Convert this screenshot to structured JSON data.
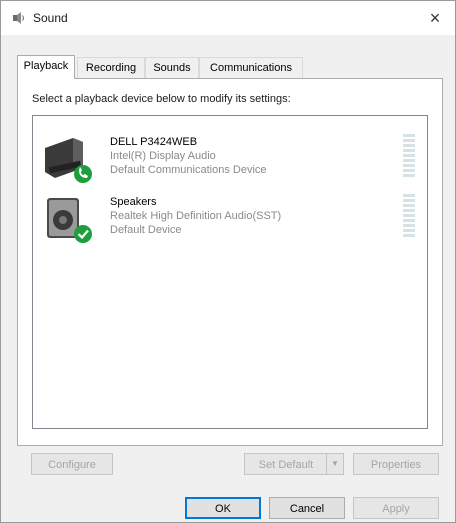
{
  "window": {
    "title": "Sound",
    "close_glyph": "×"
  },
  "tabs": [
    {
      "label": "Playback",
      "active": true
    },
    {
      "label": "Recording",
      "active": false
    },
    {
      "label": "Sounds",
      "active": false
    },
    {
      "label": "Communications",
      "active": false
    }
  ],
  "playback": {
    "instruction": "Select a playback device below to modify its settings:",
    "devices": [
      {
        "name": "DELL P3424WEB",
        "line2": "Intel(R) Display Audio",
        "line3": "Default Communications Device",
        "icon": "monitor-speaker-icon",
        "badge": "phone-badge-icon",
        "badge_color": "#1e9e3e"
      },
      {
        "name": "Speakers",
        "line2": "Realtek High Definition Audio(SST)",
        "line3": "Default Device",
        "icon": "speaker-icon",
        "badge": "checkmark-badge-icon",
        "badge_color": "#1e9e3e"
      }
    ]
  },
  "buttons": {
    "configure": "Configure",
    "set_default": "Set Default",
    "set_default_arrow": "▼",
    "properties": "Properties",
    "ok": "OK",
    "cancel": "Cancel",
    "apply": "Apply"
  },
  "colors": {
    "accent": "#0078d7",
    "disabled_text": "#a5a5a5"
  }
}
